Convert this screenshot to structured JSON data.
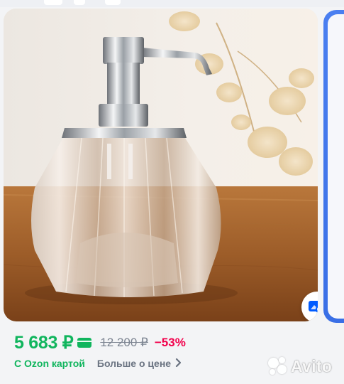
{
  "product": {
    "price_current": "5 683 ₽",
    "price_old": "12 200 ₽",
    "discount": "−53%",
    "ozon_card_label": "С Ozon картой",
    "more_price_label": "Больше о цене"
  },
  "watermark": {
    "text": "Avito"
  },
  "colors": {
    "price_green": "#10b55d",
    "discount_red": "#f2004b",
    "old_price_gray": "#7d8592",
    "accent_blue": "#3a6fe6"
  },
  "icons": {
    "image_action": "similar-search-icon",
    "card_badge": "ozon-card-icon",
    "more_price": "chevron-right-icon"
  }
}
